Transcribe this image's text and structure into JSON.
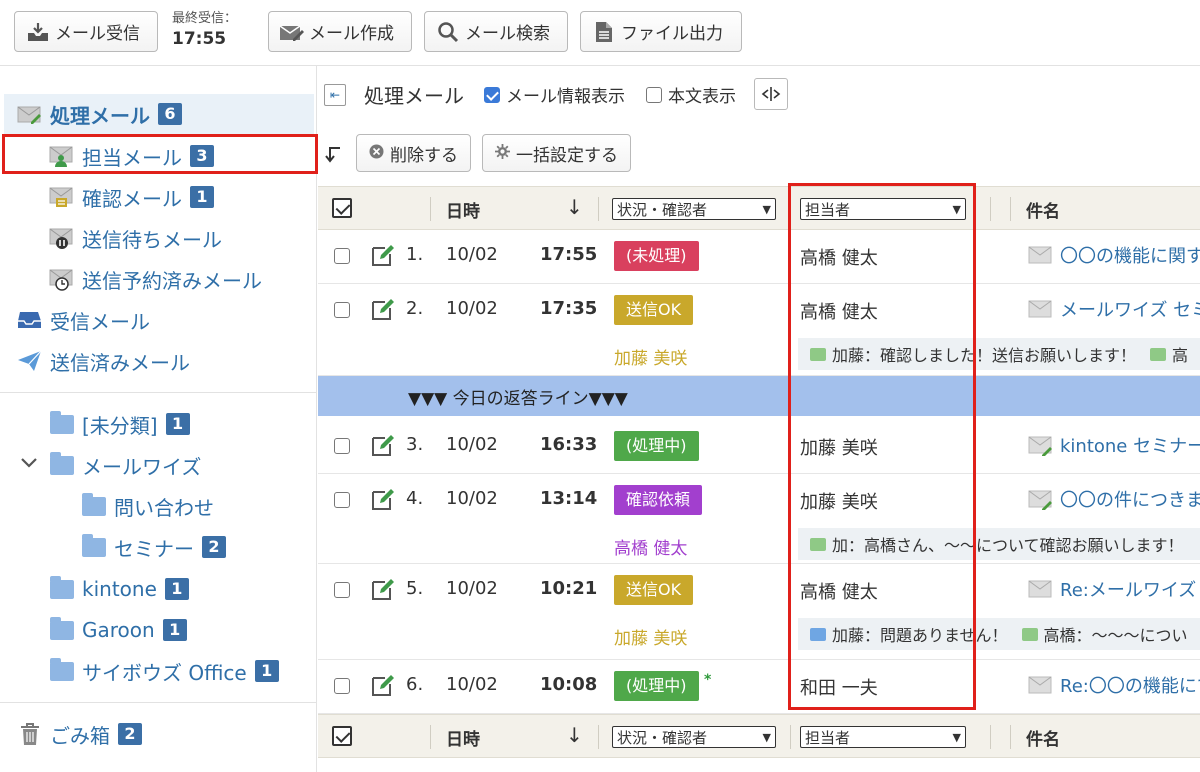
{
  "toolbar": {
    "receive_label": "メール受信",
    "last_recv_label": "最終受信：",
    "last_recv_time": "17:55",
    "compose_label": "メール作成",
    "search_label": "メール検索",
    "export_label": "ファイル出力"
  },
  "sidebar": {
    "processing": {
      "label": "処理メール",
      "count": "6"
    },
    "assigned": {
      "label": "担当メール",
      "count": "3"
    },
    "confirm": {
      "label": "確認メール",
      "count": "1"
    },
    "pending_send": {
      "label": "送信待ちメール"
    },
    "scheduled": {
      "label": "送信予約済みメール"
    },
    "inbox": {
      "label": "受信メール"
    },
    "sent": {
      "label": "送信済みメール"
    },
    "folders": [
      {
        "label": "[未分類]",
        "count": "1"
      },
      {
        "label": "メールワイズ",
        "count": ""
      },
      {
        "label": "問い合わせ",
        "count": ""
      },
      {
        "label": "セミナー",
        "count": "2"
      },
      {
        "label": "kintone",
        "count": "1"
      },
      {
        "label": "Garoon",
        "count": "1"
      },
      {
        "label": "サイボウズ Office",
        "count": "1"
      }
    ],
    "trash": {
      "label": "ごみ箱",
      "count": "2"
    }
  },
  "main": {
    "title": "処理メール",
    "show_info_label": "メール情報表示",
    "show_body_label": "本文表示",
    "delete_label": "削除する",
    "bulk_label": "一括設定する",
    "header": {
      "datetime": "日時",
      "status_select": "状況・確認者",
      "person_select": "担当者",
      "subject": "件名"
    },
    "reply_line": "▼▼▼ 今日の返答ライン▼▼▼"
  },
  "rows": [
    {
      "num": "1.",
      "date": "10/02",
      "time": "17:55",
      "status": "(未処理)",
      "status_color": "#d9405e",
      "confirmer": "",
      "person": "高橋 健太",
      "subject": "〇〇の機能に関す",
      "comments": []
    },
    {
      "num": "2.",
      "date": "10/02",
      "time": "17:35",
      "status": "送信OK",
      "status_color": "#c9a82b",
      "confirmer": "加藤 美咲",
      "confirmer_color": "#c9a82b",
      "person": "高橋 健太",
      "subject": "メールワイズ セミ",
      "comments": [
        {
          "text": "加藤：確認しました！送信お願いします！",
          "c": "green"
        },
        {
          "text": "高",
          "c": "green"
        }
      ]
    },
    {
      "num": "3.",
      "date": "10/02",
      "time": "16:33",
      "status": "(処理中)",
      "status_color": "#4fa84a",
      "confirmer": "",
      "person": "加藤 美咲",
      "subject": "kintone セミナー",
      "comments": []
    },
    {
      "num": "4.",
      "date": "10/02",
      "time": "13:14",
      "status": "確認依頼",
      "status_color": "#a23fce",
      "confirmer": "高橋 健太",
      "confirmer_color": "#a23fce",
      "person": "加藤 美咲",
      "subject": "〇〇の件につきま",
      "comments": [
        {
          "text": "加：高橋さん、〜〜について確認お願いします！",
          "c": "green"
        }
      ]
    },
    {
      "num": "5.",
      "date": "10/02",
      "time": "10:21",
      "status": "送信OK",
      "status_color": "#c9a82b",
      "confirmer": "加藤 美咲",
      "confirmer_color": "#c9a82b",
      "person": "高橋 健太",
      "subject": "Re:メールワイズ",
      "comments": [
        {
          "text": "加藤：問題ありません！",
          "c": "blue"
        },
        {
          "text": "高橋：〜〜〜につい",
          "c": "green"
        }
      ]
    },
    {
      "num": "6.",
      "date": "10/02",
      "time": "10:08",
      "status": "(処理中)",
      "status_color": "#4fa84a",
      "star": "*",
      "confirmer": "",
      "person": "和田 一夫",
      "subject": "Re:〇〇の機能にて",
      "comments": []
    }
  ]
}
